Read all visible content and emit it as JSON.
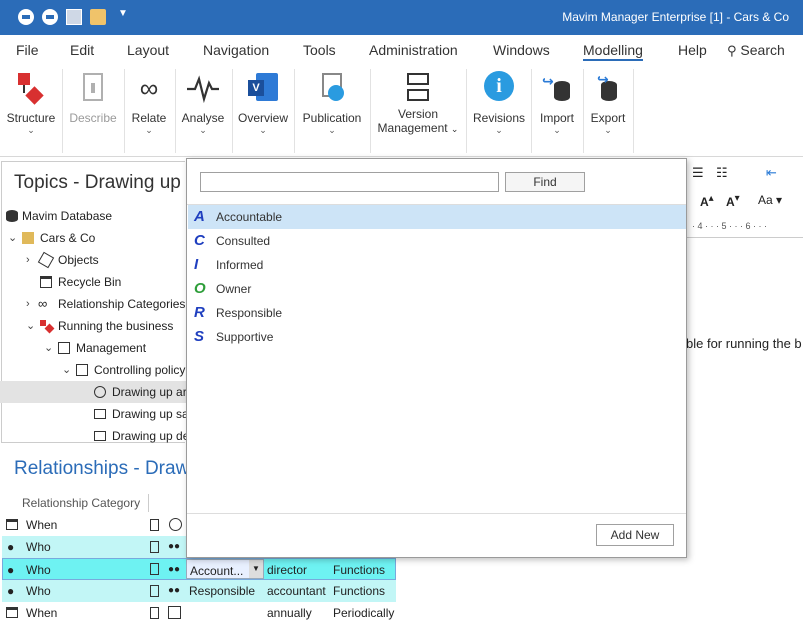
{
  "titlebar": {
    "title": "Mavim Manager Enterprise [1] - Cars & Co"
  },
  "menu": {
    "file": "File",
    "edit": "Edit",
    "layout": "Layout",
    "navigation": "Navigation",
    "tools": "Tools",
    "administration": "Administration",
    "windows": "Windows",
    "modelling": "Modelling",
    "help": "Help",
    "search": "Search"
  },
  "ribbon": {
    "structure": "Structure",
    "describe": "Describe",
    "relate": "Relate",
    "analyse": "Analyse",
    "overview": "Overview",
    "publication": "Publication",
    "version1": "Version",
    "version2": "Management",
    "revisions": "Revisions",
    "import": "Import",
    "export": "Export"
  },
  "topics": {
    "title": "Topics -  Drawing up",
    "tree": {
      "db": "Mavim Database",
      "cars": "Cars & Co",
      "objects": "Objects",
      "recycle": "Recycle Bin",
      "relcat": "Relationship Categories",
      "running": "Running the business",
      "management": "Management",
      "controlling": "Controlling policy",
      "draw1": "Drawing up ar",
      "draw2": "Drawing up sa",
      "draw3": "Drawing up de"
    }
  },
  "relationships": {
    "title": "Relationships - Draw",
    "col_category": "Relationship Category",
    "rows": [
      {
        "category": "When",
        "relation": "",
        "name": "",
        "type": ""
      },
      {
        "category": "Who",
        "relation": "",
        "name": "",
        "type": ""
      },
      {
        "category": "Who",
        "relation": "Account...",
        "name": "director",
        "type": "Functions"
      },
      {
        "category": "Who",
        "relation": "Responsible",
        "name": "accountant",
        "type": "Functions"
      },
      {
        "category": "When",
        "relation": "",
        "name": "annually",
        "type": "Periodically"
      }
    ]
  },
  "right": {
    "doc_text": "ble for running the b",
    "ruler": "· 4 · · · 5 · · · 6 · · ·"
  },
  "popup": {
    "search_value": "",
    "find": "Find",
    "options": [
      {
        "glyph": "A",
        "label": "Accountable",
        "color": "#1f3fbf"
      },
      {
        "glyph": "C",
        "label": "Consulted",
        "color": "#1f3fbf"
      },
      {
        "glyph": "I",
        "label": "Informed",
        "color": "#1f3fbf"
      },
      {
        "glyph": "O",
        "label": "Owner",
        "color": "#2e9e3a"
      },
      {
        "glyph": "R",
        "label": "Responsible",
        "color": "#1f3fbf"
      },
      {
        "glyph": "S",
        "label": "Supportive",
        "color": "#1f3fbf"
      }
    ],
    "add_new": "Add New"
  }
}
